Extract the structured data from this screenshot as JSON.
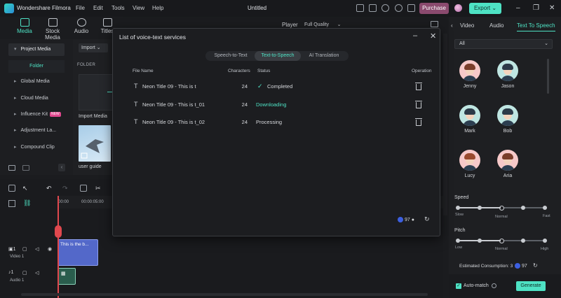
{
  "titlebar": {
    "app_name": "Wondershare Filmora",
    "menu": [
      "File",
      "Edit",
      "Tools",
      "View",
      "Help"
    ],
    "project": "Untitled",
    "purchase_label": "Purchase",
    "export_label": "Export"
  },
  "media_tabs": [
    {
      "label": "Media",
      "active": true
    },
    {
      "label": "Stock Media",
      "active": false
    },
    {
      "label": "Audio",
      "active": false
    },
    {
      "label": "Titles",
      "active": false
    }
  ],
  "sidebar": {
    "items": [
      {
        "label": "Project Media",
        "selected": true
      },
      {
        "label": "Global Media",
        "selected": false
      },
      {
        "label": "Cloud Media",
        "selected": false
      },
      {
        "label": "Influence Kit",
        "selected": false,
        "badge": "NEW"
      },
      {
        "label": "Adjustment La...",
        "selected": false
      },
      {
        "label": "Compound Clip",
        "selected": false
      }
    ],
    "folder_label": "Folder"
  },
  "media": {
    "import_label": "Import",
    "folder_heading": "FOLDER",
    "import_media_caption": "Import Media",
    "user_guide_caption": "user guide"
  },
  "player": {
    "label": "Player",
    "quality": "Full Quality"
  },
  "right_panel": {
    "tabs": [
      {
        "label": "Video",
        "active": false
      },
      {
        "label": "Audio",
        "active": false
      },
      {
        "label": "Text To Speech",
        "active": true
      }
    ],
    "filter_value": "All",
    "voices": [
      {
        "name": "Jenny",
        "bg": "#f6c9c9",
        "hair": "#7a3d2a"
      },
      {
        "name": "Jason",
        "bg": "#bfe6e2",
        "hair": "#2c3a48"
      },
      {
        "name": "Mark",
        "bg": "#bfe6e2",
        "hair": "#2c3a48"
      },
      {
        "name": "Bob",
        "bg": "#bfe6e2",
        "hair": "#2c3a48"
      },
      {
        "name": "Lucy",
        "bg": "#f6c9c9",
        "hair": "#9a4a2e"
      },
      {
        "name": "Aria",
        "bg": "#f6c9c9",
        "hair": "#7a3d2a"
      }
    ],
    "speed": {
      "label": "Speed",
      "low_label": "Slow",
      "mid_label": "Normal",
      "high_label": "Fast",
      "level": 3
    },
    "pitch": {
      "label": "Pitch",
      "low_label": "Low",
      "mid_label": "Normal",
      "high_label": "High",
      "level": 3
    },
    "estimated_label": "Estimated Consumption: 3",
    "credits": "97",
    "auto_match_label": "Auto-match",
    "auto_match_checked": true,
    "generate_label": "Generate"
  },
  "timeline": {
    "time_start": "00:00",
    "time_mark": "00:00:05:00",
    "title_clip_label": "This is the b...",
    "video_track_label": "Video 1",
    "audio_track_label": "Audio 1",
    "video_track_num": "1",
    "audio_track_num": "1"
  },
  "modal": {
    "title": "List of voice-text services",
    "tabs": [
      {
        "label": "Speech-to-Text",
        "active": false
      },
      {
        "label": "Text-to-Speech",
        "active": true
      },
      {
        "label": "AI Translation",
        "active": false
      }
    ],
    "columns": [
      "File Name",
      "Characters",
      "Status",
      "Operation"
    ],
    "rows": [
      {
        "name": "Neon Title 09 - This is t",
        "chars": "24",
        "status": "Completed",
        "status_color": "#d6d8dc",
        "check": true
      },
      {
        "name": "Neon Title 09 - This is t_01",
        "chars": "24",
        "status": "Downloading",
        "status_color": "#4ee2c4",
        "check": false
      },
      {
        "name": "Neon Title 09 - This is t_02",
        "chars": "24",
        "status": "Processing",
        "status_color": "#d6d8dc",
        "check": false
      }
    ],
    "credits": "97"
  },
  "colors": {
    "accent": "#4ee2c4",
    "purchase": "#8a4a6e",
    "playhead": "#e0484e",
    "title_clip": "#5368c9"
  }
}
